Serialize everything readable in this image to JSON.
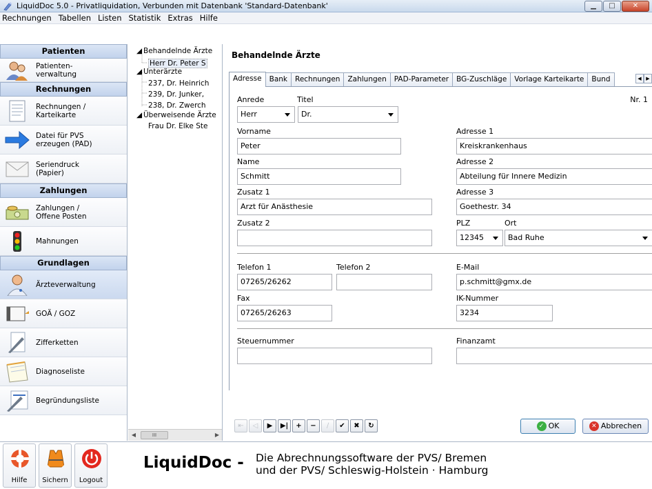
{
  "window": {
    "title": "LiquidDoc 5.0 - Privatliquidation, Verbunden mit Datenbank 'Standard-Datenbank'"
  },
  "menu": [
    "Rechnungen",
    "Tabellen",
    "Listen",
    "Statistik",
    "Extras",
    "Hilfe"
  ],
  "nav": {
    "sections": [
      {
        "header": "Patienten",
        "items": [
          {
            "label": "Patienten-\nverwaltung",
            "icon": "patients-icon"
          }
        ]
      },
      {
        "header": "Rechnungen",
        "items": [
          {
            "label": "Rechnungen /\nKarteikarte",
            "icon": "invoice-icon"
          },
          {
            "label": "Datei für PVS\nerzeugen (PAD)",
            "icon": "arrow-right-icon"
          },
          {
            "label": "Seriendruck\n(Papier)",
            "icon": "envelope-icon"
          }
        ]
      },
      {
        "header": "Zahlungen",
        "items": [
          {
            "label": "Zahlungen /\nOffene Posten",
            "icon": "money-icon"
          },
          {
            "label": "Mahnungen",
            "icon": "traffic-light-icon"
          }
        ]
      },
      {
        "header": "Grundlagen",
        "items": [
          {
            "label": "Ärzteverwaltung",
            "icon": "doctor-icon"
          },
          {
            "label": "GOÄ / GOZ",
            "icon": "book-icon"
          },
          {
            "label": "Zifferketten",
            "icon": "pen-icon"
          },
          {
            "label": "Diagnoseliste",
            "icon": "notepad-icon"
          },
          {
            "label": "Begründungsliste",
            "icon": "list-pen-icon"
          }
        ]
      }
    ]
  },
  "tree": {
    "n0": "Behandelnde Ärzte",
    "n1": "Herr Dr. Peter S",
    "n2": "Unterärzte",
    "n3": "237, Dr. Heinrich",
    "n4": "239, Dr. Junker,",
    "n5": "238, Dr. Zwerch",
    "n6": "Überweisende Ärzte",
    "n7": "Frau Dr. Elke Ste",
    "scroll_thumb": "III"
  },
  "main": {
    "title": "Behandelnde Ärzte",
    "tabs": [
      "Adresse",
      "Bank",
      "Rechnungen",
      "Zahlungen",
      "PAD-Parameter",
      "BG-Zuschläge",
      "Vorlage Karteikarte",
      "Bund"
    ],
    "form": {
      "anrede_label": "Anrede",
      "anrede": "Herr",
      "titel_label": "Titel",
      "titel": "Dr.",
      "nr": "Nr. 1",
      "vorname_label": "Vorname",
      "vorname": "Peter",
      "name_label": "Name",
      "name": "Schmitt",
      "zusatz1_label": "Zusatz 1",
      "zusatz1": "Arzt für Anästhesie",
      "zusatz2_label": "Zusatz 2",
      "zusatz2": "",
      "adresse1_label": "Adresse 1",
      "adresse1": "Kreiskrankenhaus",
      "adresse2_label": "Adresse 2",
      "adresse2": "Abteilung für Innere Medizin",
      "adresse3_label": "Adresse 3",
      "adresse3": "Goethestr. 34",
      "plz_label": "PLZ",
      "plz": "12345",
      "ort_label": "Ort",
      "ort": "Bad Ruhe",
      "telefon1_label": "Telefon 1",
      "telefon1": "07265/26262",
      "telefon2_label": "Telefon 2",
      "telefon2": "",
      "email_label": "E-Mail",
      "email": "p.schmitt@gmx.de",
      "fax_label": "Fax",
      "fax": "07265/26263",
      "ik_label": "IK-Nummer",
      "ik": "3234",
      "steuer_label": "Steuernummer",
      "steuer": "",
      "finanzamt_label": "Finanzamt",
      "finanzamt": ""
    },
    "ok_label": "OK",
    "cancel_label": "Abbrechen"
  },
  "bottom": {
    "help_label": "Hilfe",
    "backup_label": "Sichern",
    "logout_label": "Logout",
    "brand": "LiquidDoc -",
    "tagline": "Die Abrechnungssoftware der PVS/ Bremen\nund der PVS/ Schleswig-Holstein · Hamburg"
  }
}
